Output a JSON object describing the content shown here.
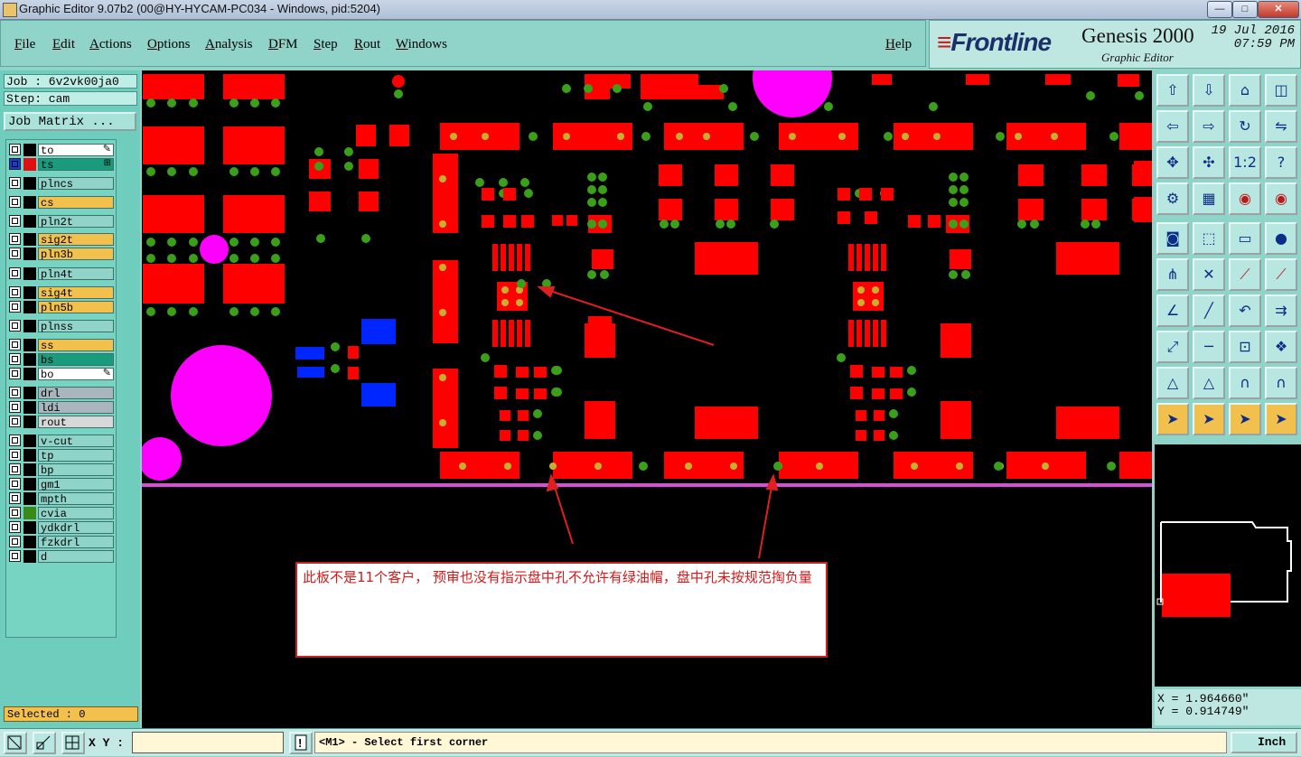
{
  "window": {
    "title": "Graphic Editor 9.07b2 (00@HY-HYCAM-PC034 - Windows, pid:5204)"
  },
  "menu": {
    "items": [
      "File",
      "Edit",
      "Actions",
      "Options",
      "Analysis",
      "DFM",
      "Step",
      "Rout",
      "Windows"
    ],
    "help": "Help"
  },
  "brand": {
    "logo": "Frontline",
    "product": "Genesis 2000",
    "subtitle": "Graphic Editor",
    "date": "19 Jul 2016",
    "time": "07:59 PM"
  },
  "job": {
    "job_label": "Job : 6v2vk00ja0",
    "step_label": "Step: cam",
    "matrix_button": "Job Matrix ..."
  },
  "layers": [
    {
      "name": "to",
      "color": "#ffffff",
      "swatch": "#000000",
      "mark": "pencil"
    },
    {
      "name": "ts",
      "color": "#1a9b7d",
      "swatch": "#e01010",
      "mark": "grid"
    },
    {
      "name": "plncs",
      "color": "#8fd3c9",
      "swatch": "#000000"
    },
    {
      "name": "cs",
      "color": "#f2c04c",
      "swatch": "#000000"
    },
    {
      "name": "pln2t",
      "color": "#8fd3c9",
      "swatch": "#000000"
    },
    {
      "name": "sig2t",
      "color": "#f2c04c",
      "swatch": "#000000"
    },
    {
      "name": "pln3b",
      "color": "#f2c04c",
      "swatch": "#000000"
    },
    {
      "name": "pln4t",
      "color": "#8fd3c9",
      "swatch": "#000000"
    },
    {
      "name": "sig4t",
      "color": "#f2c04c",
      "swatch": "#000000"
    },
    {
      "name": "pln5b",
      "color": "#f2c04c",
      "swatch": "#000000"
    },
    {
      "name": "plnss",
      "color": "#8fd3c9",
      "swatch": "#000000"
    },
    {
      "name": "ss",
      "color": "#f2c04c",
      "swatch": "#000000"
    },
    {
      "name": "bs",
      "color": "#1a9b7d",
      "swatch": "#000000"
    },
    {
      "name": "bo",
      "color": "#ffffff",
      "swatch": "#000000",
      "mark": "pencil"
    },
    {
      "name": "drl",
      "color": "#a9b6bd",
      "swatch": "#000000"
    },
    {
      "name": "ldi",
      "color": "#a9b6bd",
      "swatch": "#000000"
    },
    {
      "name": "rout",
      "color": "#d8d8d8",
      "swatch": "#000000"
    },
    {
      "name": "v-cut",
      "color": "#8fd3c9",
      "swatch": "#000000"
    },
    {
      "name": "tp",
      "color": "#8fd3c9",
      "swatch": "#000000"
    },
    {
      "name": "bp",
      "color": "#8fd3c9",
      "swatch": "#000000"
    },
    {
      "name": "gm1",
      "color": "#8fd3c9",
      "swatch": "#000000"
    },
    {
      "name": "mpth",
      "color": "#8fd3c9",
      "swatch": "#000000"
    },
    {
      "name": "cvia",
      "color": "#8fd3c9",
      "swatch": "#3a8a1a"
    },
    {
      "name": "ydkdrl",
      "color": "#8fd3c9",
      "swatch": "#000000"
    },
    {
      "name": "fzkdrl",
      "color": "#8fd3c9",
      "swatch": "#000000"
    },
    {
      "name": "d",
      "color": "#8fd3c9",
      "swatch": "#000000"
    }
  ],
  "selected": "Selected : 0",
  "annotation": {
    "text": "此板不是11个客户， 预审也没有指示盘中孔不允许有绿油帽，盘中孔未按规范掏负量"
  },
  "coords": {
    "x": "X = 1.964660\"",
    "y": "Y = 0.914749\""
  },
  "statusbar": {
    "xy_label": "X Y :",
    "xy_value": "",
    "message": "<M1> - Select first corner",
    "unit": "Inch"
  },
  "colors": {
    "pad": "#ff0000",
    "via": "#3aa01a",
    "via_center": "#c8b02a",
    "fiducial": "#ff00ff",
    "blue": "#0026ff",
    "bg": "#000000"
  },
  "toolbar_icons": [
    "zoom-home-icon",
    "zoom-fit-icon",
    "zoom-page-icon",
    "split-view-icon",
    "pan-left-icon",
    "pan-right-icon",
    "rotate-icon",
    "mirror-icon",
    "zoom-in-icon",
    "zoom-out-icon",
    "scale-1-2-icon",
    "help-query-icon",
    "measure-icon",
    "grid-icon",
    "layer-compare-icon",
    "layer-compare-red-icon",
    "snap-center-icon",
    "draw-line-icon",
    "ruler-icon",
    "pad-icon",
    "route-icon",
    "cross-icon",
    "add-line-icon",
    "add-pad-icon",
    "angle-icon",
    "slash-icon",
    "undo-arc-icon",
    "align-icon",
    "move-icon",
    "cut-icon",
    "box-center-icon",
    "group-icon",
    "triangle-icon",
    "triangle-up-icon",
    "arch-icon",
    "arch-line-icon",
    "select-arrow-icon",
    "select-box-icon",
    "select-circle-icon",
    "select-net-icon"
  ]
}
